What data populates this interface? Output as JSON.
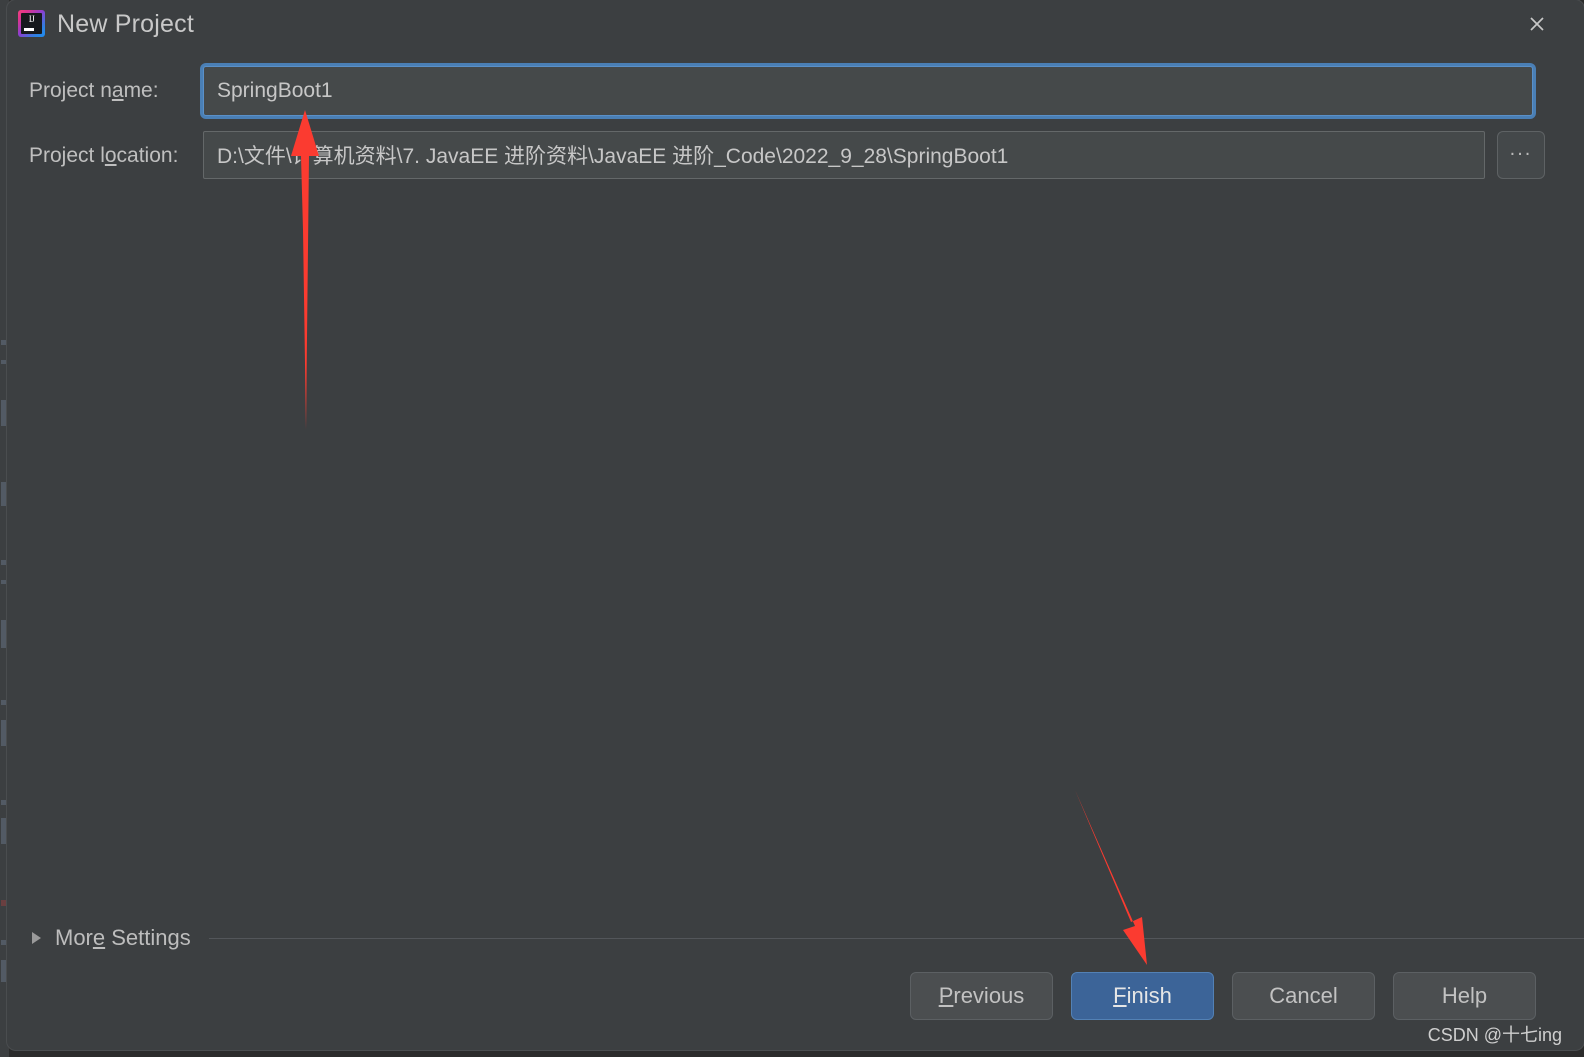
{
  "window": {
    "title": "New Project",
    "app_icon": "intellij-idea-icon",
    "icon_text": "IJ",
    "close_icon": "close-icon"
  },
  "form": {
    "name_label_before": "Project n",
    "name_label_mnemonic": "a",
    "name_label_after": "me:",
    "name_value": "SpringBoot1",
    "location_label_before": "Project l",
    "location_label_mnemonic": "o",
    "location_label_after": "cation:",
    "location_value": "D:\\文件\\计算机资料\\7. JavaEE 进阶资料\\JavaEE 进阶_Code\\2022_9_28\\SpringBoot1",
    "browse_label": "...",
    "browse_icon": "ellipsis-icon"
  },
  "more_settings": {
    "label_before": "Mor",
    "label_mnemonic": "e",
    "label_after": " Settings",
    "expander_icon": "chevron-right-icon",
    "expanded": false
  },
  "footer": {
    "buttons": [
      {
        "id": "previous",
        "before": "",
        "mnemonic": "P",
        "after": "revious",
        "primary": false
      },
      {
        "id": "finish",
        "before": "",
        "mnemonic": "F",
        "after": "inish",
        "primary": true
      },
      {
        "id": "cancel",
        "before": "Cancel",
        "mnemonic": "",
        "after": "",
        "primary": false
      },
      {
        "id": "help",
        "before": "Help",
        "mnemonic": "",
        "after": "",
        "primary": false
      }
    ]
  },
  "annotations": {
    "arrow_color": "#fb3b30",
    "arrow_up_name": "annotation-arrow-up-to-project-name",
    "arrow_diag_name": "annotation-arrow-to-finish-button"
  },
  "watermark": {
    "text": "CSDN @十七ing"
  },
  "colors": {
    "dialog_background": "#3c3f41",
    "field_background": "#45494a",
    "focus_ring": "#4a7fb5",
    "primary_button": "#3c6498",
    "label_text": "#bfbfbf"
  }
}
